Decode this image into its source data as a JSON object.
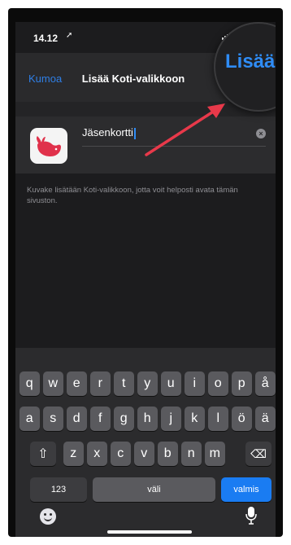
{
  "status_bar": {
    "time": "14.12",
    "location_glyph": "➚"
  },
  "nav": {
    "cancel": "Kumoa",
    "title": "Lisää Koti-valikkoon",
    "add": "Lisää"
  },
  "form": {
    "name_value": "Jäsenkortti",
    "clear_glyph": "×"
  },
  "hint": "Kuvake lisätään Koti-valikkoon, jotta voit helposti avata tämän sivuston.",
  "keyboard": {
    "row1": [
      "q",
      "w",
      "e",
      "r",
      "t",
      "y",
      "u",
      "i",
      "o",
      "p",
      "å"
    ],
    "row2": [
      "a",
      "s",
      "d",
      "f",
      "g",
      "h",
      "j",
      "k",
      "l",
      "ö",
      "ä"
    ],
    "row3": [
      "z",
      "x",
      "c",
      "v",
      "b",
      "n",
      "m"
    ],
    "shift_glyph": "⇧",
    "delete_glyph": "⌫",
    "numbers": "123",
    "space": "väli",
    "go": "valmis"
  },
  "colors": {
    "accent": "#2f8cf5",
    "arrow": "#e8394a",
    "icon_bg": "#f4f4f4",
    "icon_fg": "#e0314b"
  }
}
